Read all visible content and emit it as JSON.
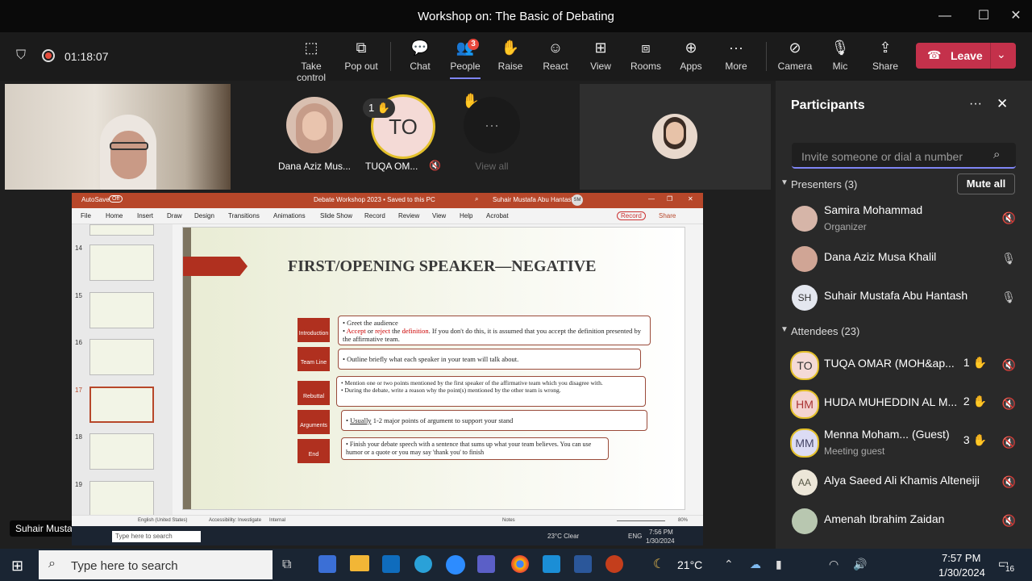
{
  "window": {
    "title": "Workshop on: The Basic of Debating"
  },
  "meeting": {
    "timer": "01:18:07"
  },
  "toolbar": {
    "take_control": "Take control",
    "pop_out": "Pop out",
    "chat": "Chat",
    "people": "People",
    "people_badge": "3",
    "raise": "Raise",
    "react": "React",
    "view": "View",
    "rooms": "Rooms",
    "apps": "Apps",
    "more": "More",
    "camera": "Camera",
    "mic": "Mic",
    "share": "Share",
    "leave": "Leave"
  },
  "stage": {
    "tile_dana": "Dana Aziz Mus...",
    "tile_tuqa": "TUQA OM...",
    "tuqa_initials": "TO",
    "tuqa_hand": "1",
    "view_all": "View all",
    "speaker_label": "Suhair Mustafa Abu Hantash"
  },
  "panel": {
    "title": "Participants",
    "invite_placeholder": "Invite someone or dial a number",
    "presenters_header": "Presenters (3)",
    "mute_all": "Mute all",
    "attendees_header": "Attendees (23)",
    "presenters": [
      {
        "name": "Samira Mohammad",
        "sub": "Organizer"
      },
      {
        "name": "Dana Aziz Musa Khalil"
      },
      {
        "name": "Suhair Mustafa Abu Hantash",
        "initials": "SH"
      }
    ],
    "attendees": [
      {
        "initials": "TO",
        "name": "TUQA OMAR (MOH&ap...",
        "hand": "1"
      },
      {
        "initials": "HM",
        "name": "HUDA MUHEDDIN AL M...",
        "hand": "2"
      },
      {
        "initials": "MM",
        "name": "Menna Moham...   (Guest)",
        "sub": "Meeting guest",
        "hand": "3"
      },
      {
        "initials": "AA",
        "name": "Alya Saeed Ali Khamis Alteneiji"
      },
      {
        "name": "Amenah Ibrahim Zaidan"
      }
    ]
  },
  "ppt": {
    "autosave": "AutoSave",
    "toggle": "Off",
    "title": "Debate Workshop 2023 • Saved to this PC",
    "user": "Suhair Mustafa Abu Hantash",
    "user_initials": "SM",
    "menu": [
      "File",
      "Home",
      "Insert",
      "Draw",
      "Design",
      "Transitions",
      "Animations",
      "Slide Show",
      "Record",
      "Review",
      "View",
      "Help",
      "Acrobat"
    ],
    "record_btn": "Record",
    "share_btn": "Share",
    "thumb_numbers": [
      "14",
      "15",
      "16",
      "17",
      "18",
      "19"
    ],
    "slide": {
      "heading": "FIRST/OPENING SPEAKER—NEGATIVE",
      "steps": [
        "Introduction",
        "Team Line",
        "Rebuttal",
        "Arguments",
        "End"
      ],
      "intro_b1": "Greet the audience",
      "intro_b2_a": "Accept",
      "intro_b2_or": " or ",
      "intro_b2_b": "reject",
      "intro_b2_the": " the ",
      "intro_b2_c": "definition",
      "intro_b2_rest": ". If you don't do this, it is assumed that you accept the definition presented by the affirmative team.",
      "teamline": "Outline briefly what each speaker in your team will talk about.",
      "rebuttal_1": "Mention one or two points mentioned by the first speaker of the affirmative team which you disagree with.",
      "rebuttal_2": "During the debate, write a reason why the point(s) mentioned by the other team is wrong.",
      "arguments_u": "Usually",
      "arguments_rest": " 1-2 major points of argument to support your stand",
      "end": "Finish your debate speech with a sentence that sums up what your team believes. You can use humor or a quote or you may say 'thank you' to finish"
    },
    "status": {
      "lang": "English (United States)",
      "access": "Accessibility: Investigate",
      "internal": "Internal",
      "notes": "Notes",
      "zoom": "80%"
    },
    "inner_taskbar": {
      "search": "Type here to search",
      "weather": "23°C  Clear",
      "lang": "ENG",
      "time": "7:56 PM",
      "date": "1/30/2024"
    }
  },
  "taskbar": {
    "search_placeholder": "Type here to search",
    "temp": "21°C",
    "time": "7:57 PM",
    "date": "1/30/2024",
    "notif": "16"
  }
}
